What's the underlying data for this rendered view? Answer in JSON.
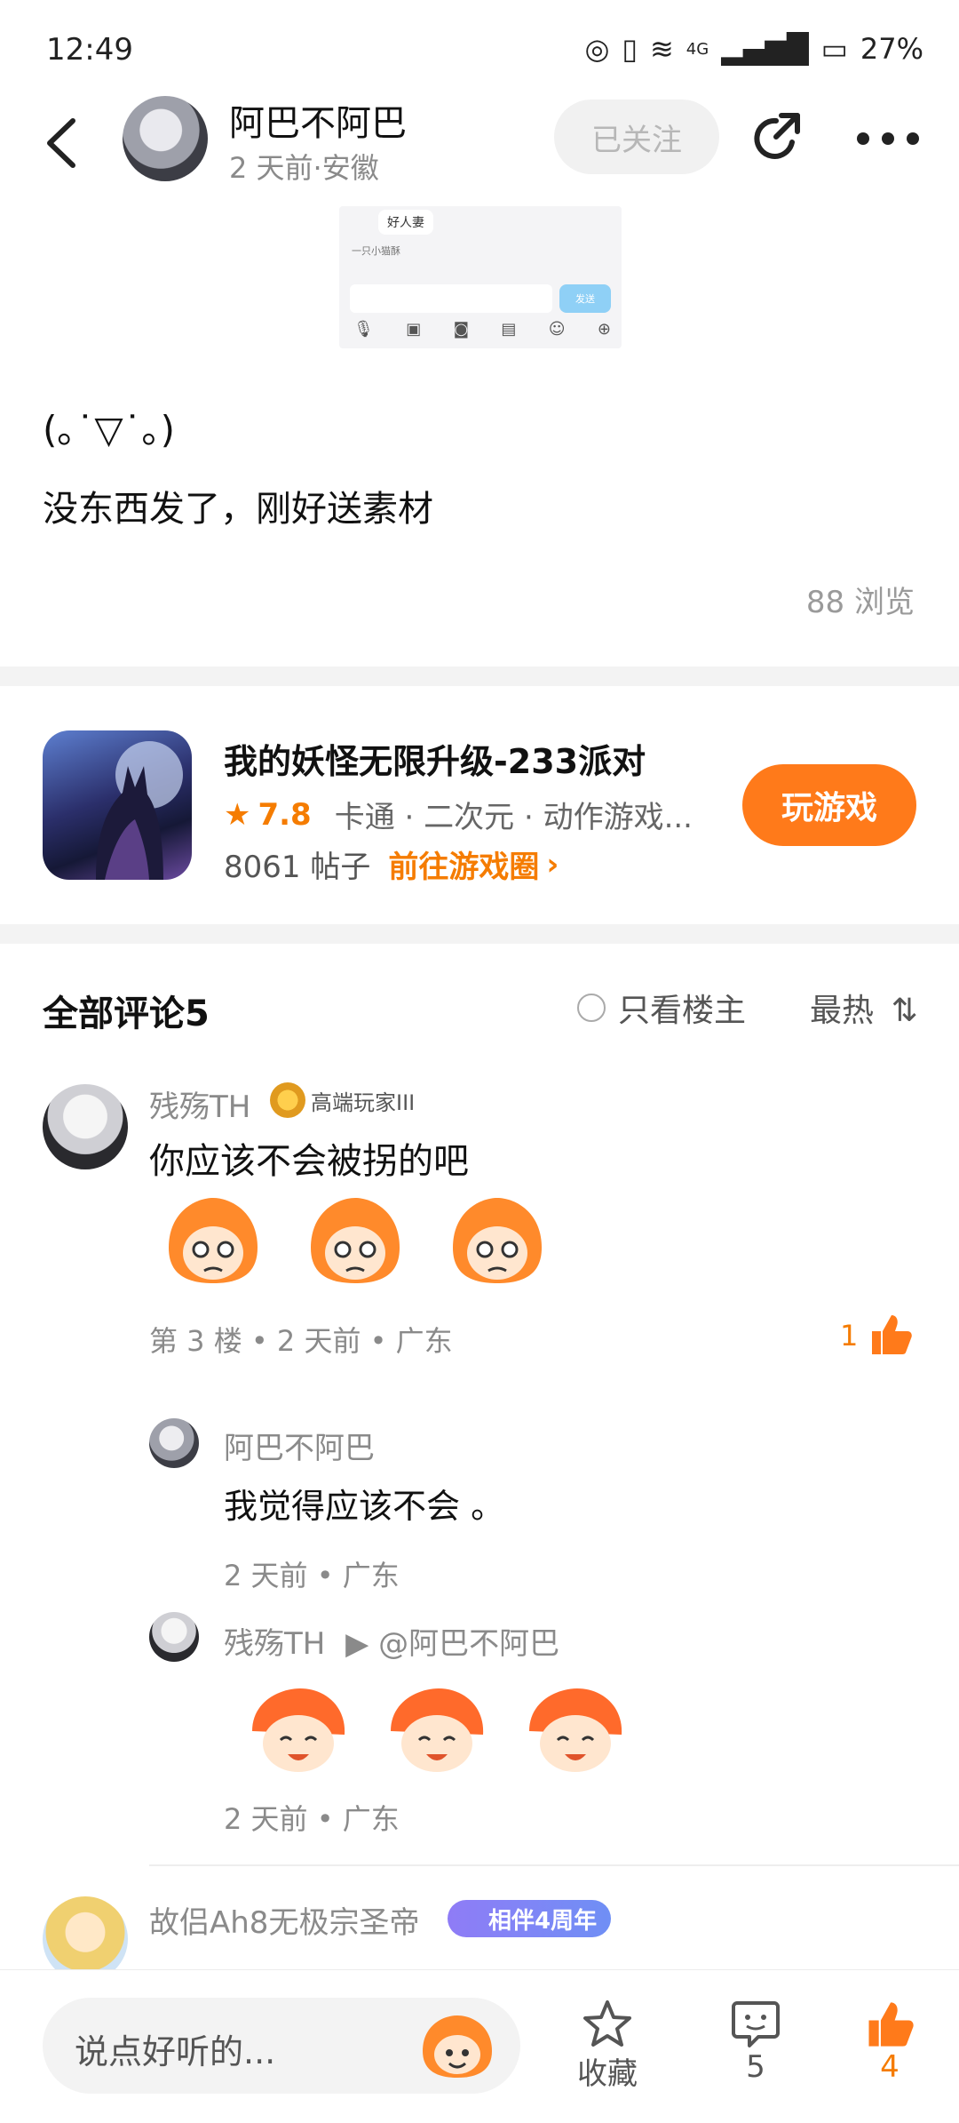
{
  "status_bar": {
    "time": "12:49",
    "network": "4G",
    "battery": "27%"
  },
  "header": {
    "author": "阿巴不阿巴",
    "meta": "2 天前·安徽",
    "follow_label": "已关注"
  },
  "post": {
    "thumbnail": {
      "bubble": "好人妻",
      "row": "一只小猫酥",
      "send": "发送"
    },
    "kaomoji": "(｡˙▽˙｡)",
    "text": "没东西发了，刚好送素材",
    "views": "88 浏览"
  },
  "game_card": {
    "title": "我的妖怪无限升级-233派对",
    "rating": "7.8",
    "tags": "卡通 · 二次元 · 动作游戏...",
    "posts": "8061 帖子",
    "goto_label": "前往游戏圈",
    "play_label": "玩游戏"
  },
  "comments": {
    "title": "全部评论5",
    "only_op_label": "只看楼主",
    "sort_label": "最热",
    "items": [
      {
        "name": "残殇TH",
        "badge": "高端玩家III",
        "text": "你应该不会被拐的吧",
        "meta": "第 3 楼 • 2 天前 • 广东",
        "likes": "1",
        "replies": [
          {
            "name": "阿巴不阿巴",
            "text": "我觉得应该不会 。",
            "meta": "2 天前 • 广东"
          },
          {
            "name": "残殇TH",
            "reply_to": "▶ @阿巴不阿巴",
            "meta": "2 天前 • 广东"
          }
        ]
      },
      {
        "name": "故侣Ah8无极宗圣帝",
        "badge": "相伴4周年"
      }
    ]
  },
  "bottom_bar": {
    "input_placeholder": "说点好听的...",
    "collect_label": "收藏",
    "comment_count": "5",
    "like_count": "4"
  },
  "colors": {
    "accent": "#ff7a1a",
    "accent_text": "#f57c00"
  }
}
